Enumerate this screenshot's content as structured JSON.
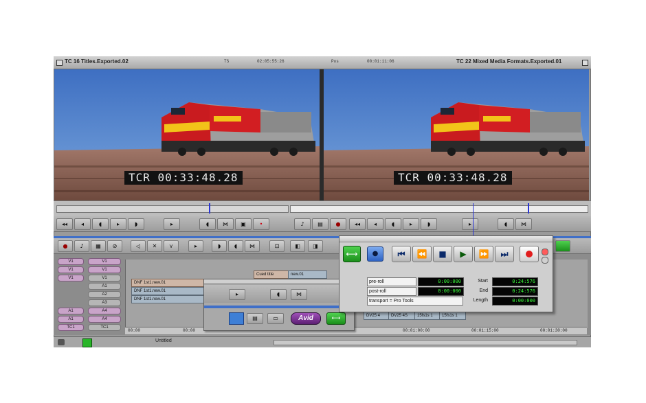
{
  "titlebar": {
    "left_title": "TC 16 Titles.Exported.02",
    "left_meta_a": "TS",
    "left_meta_b": "02:05:55:26",
    "right_meta_a": "Pos",
    "right_meta_b": "00:01:11:06",
    "right_title": "TC 22 Mixed Media Formats.Exported.01"
  },
  "monitors": {
    "source_tcr": "TCR 00:33:48.28",
    "record_tcr": "TCR 00:33:48.28"
  },
  "timeline": {
    "track_buttons_left": [
      "V1",
      "V1",
      "V1",
      "",
      "",
      "",
      "A1",
      "A1",
      "TC1"
    ],
    "track_buttons_right": [
      "V1",
      "V1",
      "V1",
      "A1",
      "A2",
      "A3",
      "A4",
      "A4",
      "TC1"
    ],
    "clip_label_upper": "Cued title",
    "clip_label_upper_2": "new.01",
    "clip_rows": [
      "DNF 1st1.new.01",
      "DNF 1st1.new.01",
      "DNF 1st1.new.01"
    ],
    "bottom_clips": [
      "DV25 4",
      "DV25 4S",
      "15fs1s 1",
      "15fs1s 1"
    ],
    "ruler_ticks": [
      "00:00",
      "00:00",
      "00:01:00:00",
      "00:01:15:00",
      "00:01:30:00"
    ],
    "status_text": "Untitled"
  },
  "floating_palette": {
    "avid_label": "Avid"
  },
  "transport": {
    "preroll_label": "pre-roll",
    "preroll_value": "0:00:000",
    "postroll_label": "post-roll",
    "postroll_value": "0:00:000",
    "transport_selector": "transport = Pro Tools",
    "start_label": "Start",
    "start_value": "0:24:576",
    "end_label": "End",
    "end_value": "0:24:576",
    "length_label": "Length",
    "length_value": "0:00:000"
  },
  "colors": {
    "accent_blue": "#3f6fc8",
    "record_red": "#e11d1d",
    "lcd_green": "#3bff3b",
    "avid_purple": "#7a2f95",
    "clip_pink": "#c9a4c9"
  },
  "icons": {
    "link": "link-arrows-icon",
    "sync": "sync-icon",
    "go_start": "go-to-start-icon",
    "rewind": "rewind-icon",
    "stop": "stop-icon",
    "play": "play-icon",
    "fast_forward": "fast-forward-icon",
    "go_end": "go-to-end-icon",
    "record": "record-icon"
  }
}
